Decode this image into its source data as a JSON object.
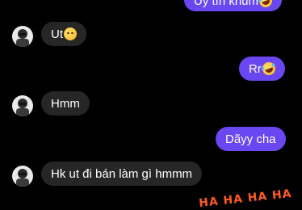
{
  "messages": [
    {
      "id": "m0",
      "direction": "outgoing",
      "text": "Uy tín khum",
      "emoji": "rolling-on-floor-laughing"
    },
    {
      "id": "m1",
      "direction": "incoming",
      "text": "Ut",
      "emoji": "face-holding-back-tears"
    },
    {
      "id": "m2",
      "direction": "outgoing",
      "text": "Rr",
      "emoji": "rolling-on-floor-laughing"
    },
    {
      "id": "m3",
      "direction": "incoming",
      "text": "Hmm"
    },
    {
      "id": "m4",
      "direction": "outgoing",
      "text": "Dãyy cha"
    },
    {
      "id": "m5",
      "direction": "incoming",
      "text": "Hk ut đi bán làm gì hmmm"
    }
  ],
  "sticker": {
    "text": "HA HA HA HA"
  },
  "colors": {
    "background": "#000000",
    "incoming_bubble": "#262626",
    "outgoing_bubble": "#6a47f0",
    "text": "#ffffff",
    "sticker": "#ff5a1f"
  }
}
